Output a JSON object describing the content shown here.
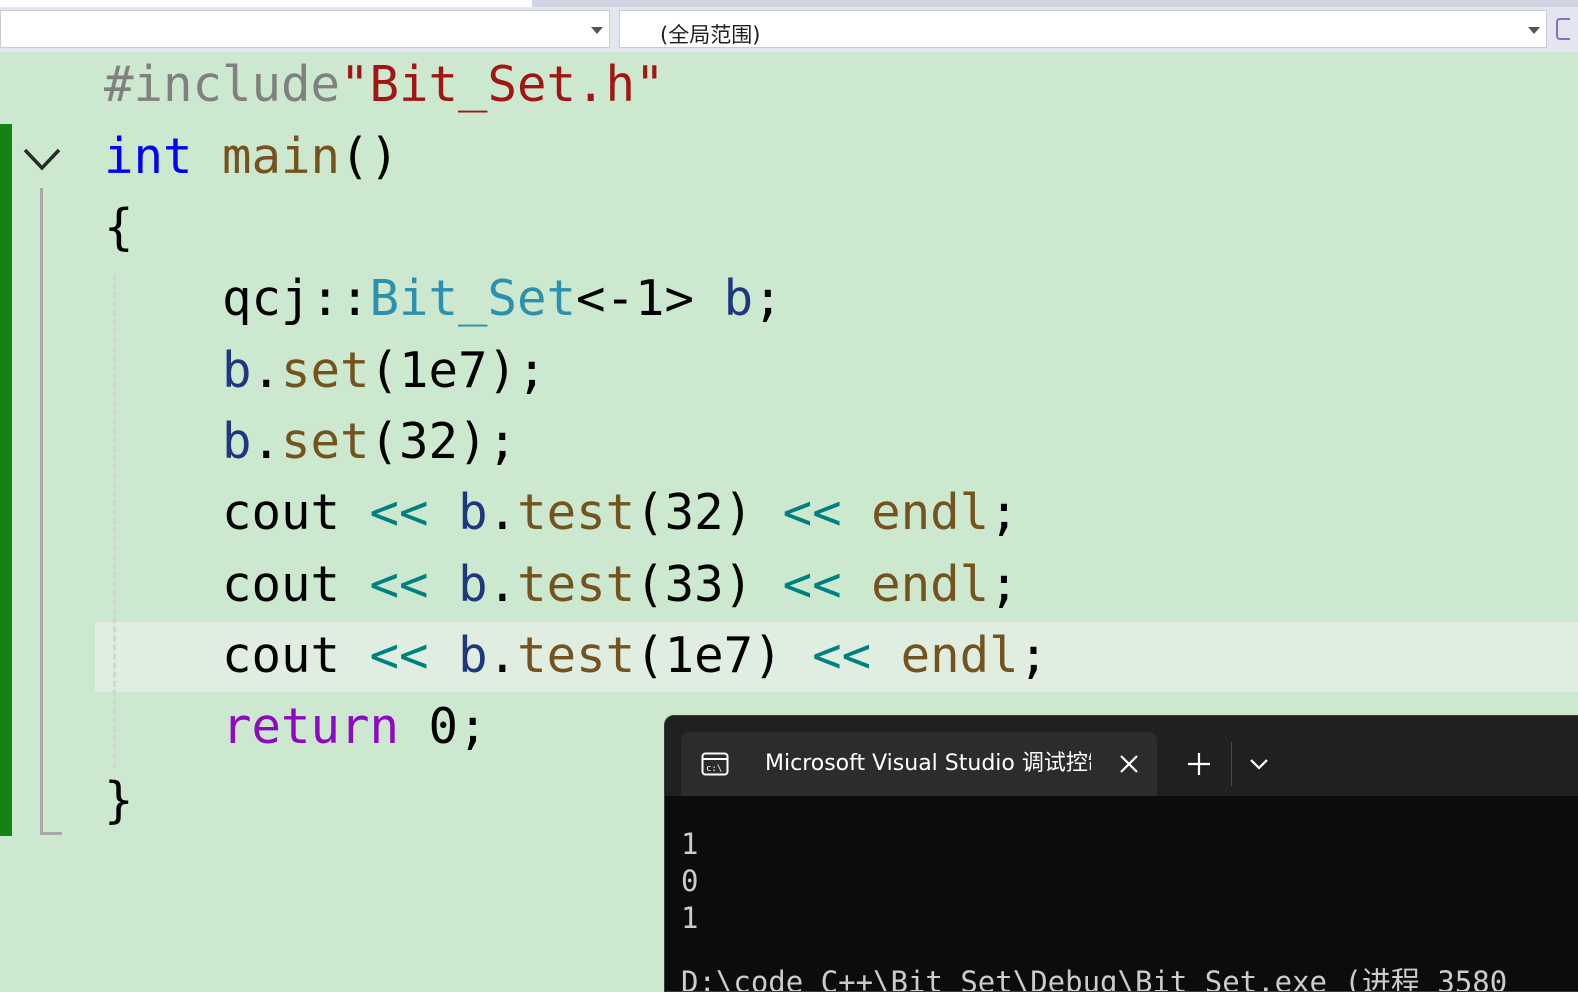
{
  "navbar": {
    "left_dropdown_value": "",
    "scope_dropdown_value": "(全局范围)"
  },
  "code": {
    "line1": {
      "directive": "#include",
      "header": "\"Bit_Set.h\""
    },
    "line2": {
      "keyword": "int",
      "function": "main",
      "parens": "()"
    },
    "line3": "{",
    "line4": {
      "namespace": "qcj::",
      "type": "Bit_Set",
      "template_args": "<-1>",
      "variable": "b",
      "end": ";"
    },
    "line5": {
      "object": "b",
      "dot": ".",
      "method": "set",
      "args": "(1e7);"
    },
    "line6": {
      "object": "b",
      "dot": ".",
      "method": "set",
      "args": "(32);"
    },
    "line7": {
      "stream": "cout",
      "op1": "<<",
      "object": "b",
      "dot": ".",
      "method": "test",
      "args": "(32)",
      "op2": "<<",
      "endl": "endl",
      "end": ";"
    },
    "line8": {
      "stream": "cout",
      "op1": "<<",
      "object": "b",
      "dot": ".",
      "method": "test",
      "args": "(33)",
      "op2": "<<",
      "endl": "endl",
      "end": ";"
    },
    "line9": {
      "stream": "cout",
      "op1": "<<",
      "object": "b",
      "dot": ".",
      "method": "test",
      "args": "(1e7)",
      "op2": "<<",
      "endl": "endl",
      "end": ";"
    },
    "line10": {
      "keyword": "return",
      "value": "0;"
    },
    "line11": "}"
  },
  "terminal": {
    "tab_title": "Microsoft Visual Studio 调试控制台",
    "tab_icon": "console-icon",
    "output": [
      "1",
      "0",
      "1"
    ],
    "path_line": "D:\\code C++\\Bit Set\\Debug\\Bit Set.exe (进程 3580"
  },
  "colors": {
    "editor_background": "#cce8cf",
    "keyword": "#0000ff",
    "string": "#a31515",
    "function": "#74531f",
    "variable": "#1f377f",
    "type": "#2b91af",
    "operator": "#008080",
    "control_keyword": "#8f08c4",
    "change_marker": "#168216"
  }
}
